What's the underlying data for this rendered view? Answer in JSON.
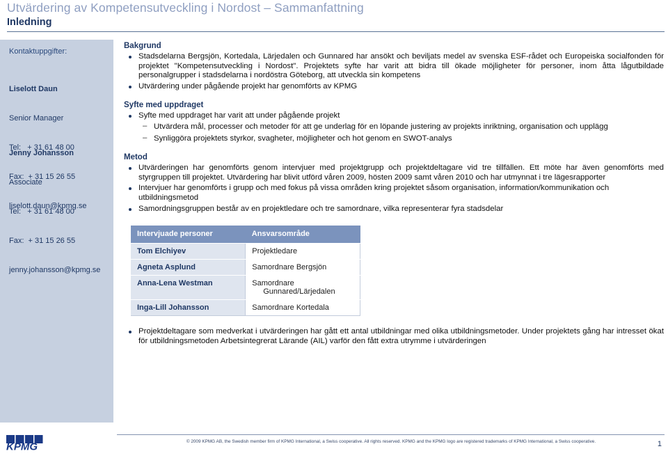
{
  "header": {
    "deck_title": "Utvärdering av Kompetensutveckling i Nordost – Sammanfattning",
    "slide_title": "Inledning"
  },
  "sidebar": {
    "label": "Kontaktuppgifter:",
    "contacts": [
      {
        "name": "Liselott Daun",
        "role": "Senior Manager",
        "tel": "Tel:   + 31 61 48 00",
        "fax": "Fax:  + 31 15 26 55",
        "email": "liselott.daun@kpmg.se"
      },
      {
        "name": "Jenny Johansson",
        "role": "Associate",
        "tel": "Tel:   + 31 61 48 00",
        "fax": "Fax:  + 31 15 26 55",
        "email": "jenny.johansson@kpmg.se"
      }
    ]
  },
  "main": {
    "bakgrund": {
      "heading": "Bakgrund",
      "bullets": [
        "Stadsdelarna Bergsjön, Kortedala, Lärjedalen och Gunnared har ansökt och beviljats medel av svenska ESF-rådet och Europeiska socialfonden för projektet \"Kompetensutveckling i Nordost\". Projektets syfte har varit att bidra till ökade möjligheter för personer, inom åtta lågutbildade personalgrupper i stadsdelarna i nordöstra Göteborg, att utveckla sin kompetens",
        "Utvärdering under pågående projekt har genomförts av KPMG"
      ]
    },
    "syfte": {
      "heading": "Syfte med uppdraget",
      "bullet": "Syfte med uppdraget har varit att under pågående projekt",
      "subbullets": [
        "Utvärdera mål, processer och metoder för att ge underlag för en löpande justering av projekts inriktning, organisation och upplägg",
        "Synliggöra projektets styrkor, svagheter, möjligheter och hot genom en SWOT-analys"
      ]
    },
    "metod": {
      "heading": "Metod",
      "bullets": [
        "Utvärderingen har genomförts genom intervjuer med projektgrupp och projektdeltagare vid tre tillfällen. Ett möte har även genomförts med styrgruppen till projektet. Utvärdering  har blivit utförd våren 2009, hösten 2009 samt våren 2010 och har utmynnat i tre lägesrapporter",
        "Intervjuer har genomförts i grupp och med fokus på vissa områden kring projektet såsom organisation, information/kommunikation och utbildningsmetod",
        "Samordningsgruppen består av en projektledare och tre samordnare, vilka representerar fyra stadsdelar"
      ]
    },
    "table": {
      "columns": [
        "Intervjuade personer",
        "Ansvarsområde"
      ],
      "rows": [
        {
          "name": "Tom Elchiyev",
          "role": "Projektledare",
          "role_line2": ""
        },
        {
          "name": "Agneta Asplund",
          "role": "Samordnare Bergsjön",
          "role_line2": ""
        },
        {
          "name": "Anna-Lena Westman",
          "role": "Samordnare",
          "role_line2": "Gunnared/Lärjedalen"
        },
        {
          "name": "Inga-Lill  Johansson",
          "role": "Samordnare Kortedala",
          "role_line2": ""
        }
      ]
    },
    "tail_bullets": [
      "Projektdeltagare som medverkat i utvärderingen har gått ett antal utbildningar med olika utbildningsmetoder. Under projektets gång har intresset ökat för utbildningsmetoden Arbetsintegrerat Lärande (AIL) varför den fått extra utrymme i utvärderingen"
    ]
  },
  "footer": {
    "copyright": "© 2009 KPMG AB, the Swedish member firm of KPMG International, a Swiss cooperative. All rights reserved. KPMG and the KPMG logo are registered trademarks of KPMG International, a Swiss cooperative.",
    "page_number": "1",
    "logo_text": "KPMG"
  },
  "colors": {
    "header_deck": "#8f9fc1",
    "brand_navy": "#1f3864",
    "sidebar_bg": "#c6d0e0",
    "table_header_bg": "#7b93bd",
    "table_name_bg": "#dfe5ef"
  }
}
